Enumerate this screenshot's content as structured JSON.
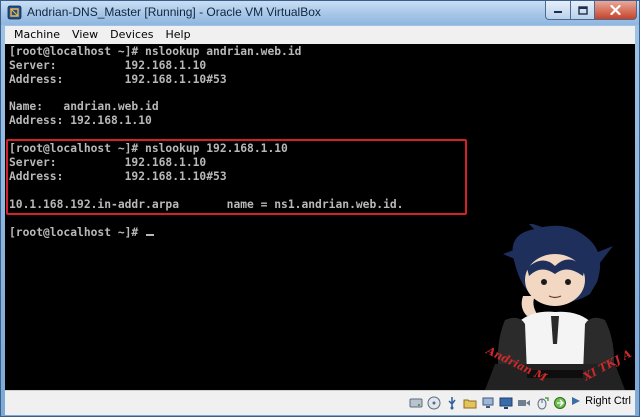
{
  "window": {
    "title": "Andrian-DNS_Master [Running] - Oracle VM VirtualBox"
  },
  "menubar": {
    "items": [
      "Machine",
      "View",
      "Devices",
      "Help"
    ]
  },
  "terminal": {
    "lines": [
      "[root@localhost ~]# nslookup andrian.web.id",
      "Server:          192.168.1.10",
      "Address:         192.168.1.10#53",
      "",
      "Name:   andrian.web.id",
      "Address: 192.168.1.10",
      "",
      "[root@localhost ~]# nslookup 192.168.1.10",
      "Server:          192.168.1.10",
      "Address:         192.168.1.10#53",
      "",
      "10.1.168.192.in-addr.arpa       name = ns1.andrian.web.id.",
      "",
      "[root@localhost ~]# "
    ]
  },
  "watermark": {
    "name": "Andrian M",
    "class": "XI TKJ A"
  },
  "statusbar": {
    "icons": [
      "hard-disk-icon",
      "optical-drive-icon",
      "usb-icon",
      "shared-folder-icon",
      "network-icon",
      "display-icon",
      "video-capture-icon",
      "mouse-integration-icon",
      "keyboard-capture-icon"
    ],
    "host_key_label": "Right Ctrl"
  },
  "colors": {
    "terminal_bg": "#000000",
    "terminal_fg": "#b8b8b8",
    "highlight": "#d42027"
  }
}
